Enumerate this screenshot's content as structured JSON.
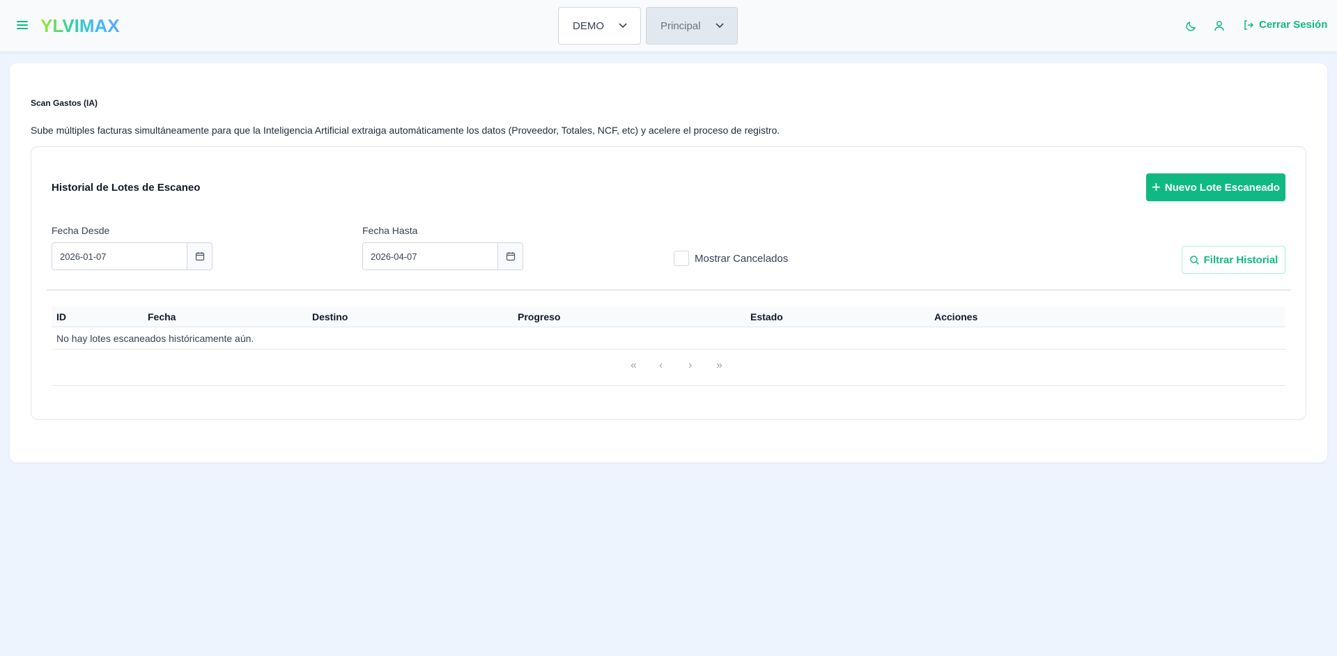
{
  "header": {
    "logo": "YLVIMAX",
    "company_select": "DEMO",
    "branch_select": "Principal",
    "logout_label": "Cerrar Sesión",
    "icons": [
      "menu-icon",
      "moon-icon",
      "user-icon",
      "logout-icon"
    ]
  },
  "page": {
    "title": "Scan Gastos (IA)",
    "description": "Sube múltiples facturas simultáneamente para que la Inteligencia Artificial extraiga automáticamente los datos (Proveedor, Totales, NCF, etc) y acelere el proceso de registro."
  },
  "history": {
    "title": "Historial de Lotes de Escaneo",
    "new_button": "Nuevo Lote Escaneado",
    "filters": {
      "date_from_label": "Fecha Desde",
      "date_from_value": "2026-01-07",
      "date_to_label": "Fecha Hasta",
      "date_to_value": "2026-04-07",
      "show_cancelled_label": "Mostrar Cancelados",
      "show_cancelled_checked": false,
      "filter_button": "Filtrar Historial"
    },
    "table": {
      "columns": [
        "ID",
        "Fecha",
        "Destino",
        "Progreso",
        "Estado",
        "Acciones"
      ],
      "empty_message": "No hay lotes escaneados históricamente aún."
    },
    "pagination": {
      "first": "«",
      "prev": "‹",
      "next": "›",
      "last": "»"
    }
  },
  "colors": {
    "accent": "#10b981",
    "background": "#eef4fe"
  }
}
